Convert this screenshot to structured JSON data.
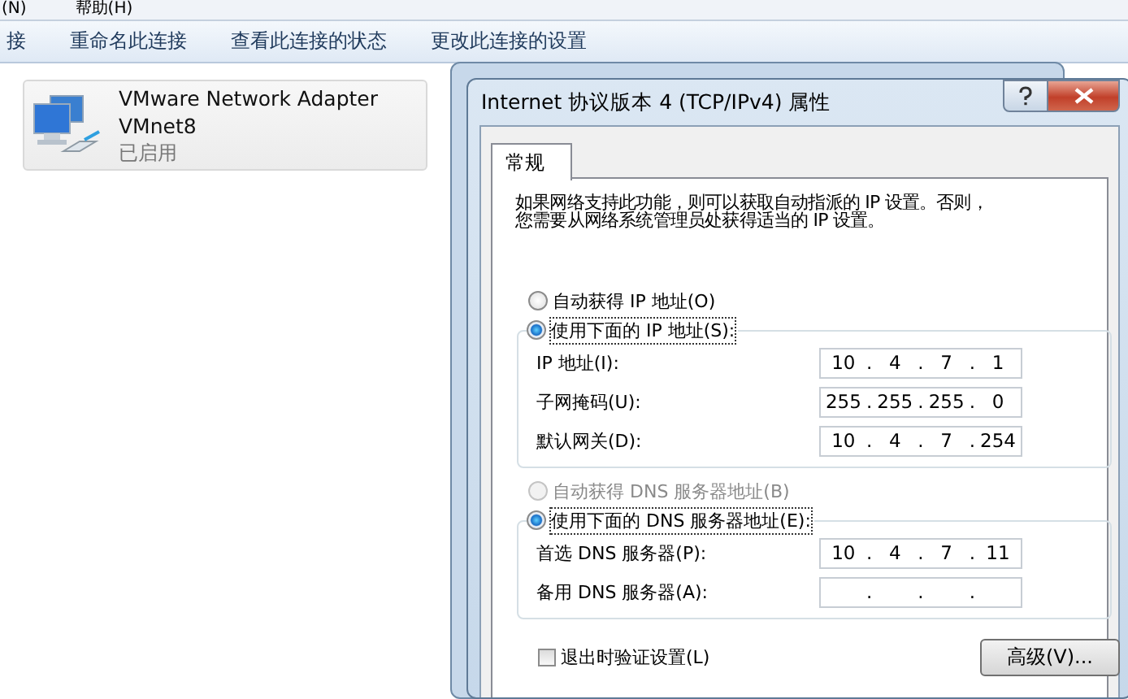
{
  "menu_bar": {
    "items": [
      "(N)",
      "帮助(H)"
    ]
  },
  "toolbar": {
    "items": [
      "接",
      "重命名此连接",
      "查看此连接的状态",
      "更改此连接的设置"
    ]
  },
  "adapter": {
    "name": "VMware Network Adapter",
    "network": "VMnet8",
    "status": "已启用"
  },
  "dialog": {
    "title": "Internet 协议版本 4 (TCP/IPv4) 属性",
    "tabs": [
      {
        "label": "常规",
        "selected": true
      }
    ],
    "description_lines": [
      "如果网络支持此功能，则可以获取自动指派的 IP 设置。否则，",
      "您需要从网络系统管理员处获得适当的 IP 设置。"
    ],
    "ip_mode": [
      {
        "label": "自动获得 IP 地址(O)",
        "selected": false,
        "disabled": false
      },
      {
        "label": "使用下面的 IP 地址(S):",
        "selected": true,
        "disabled": false
      }
    ],
    "ip_fields": [
      {
        "label": "IP 地址(I):",
        "octets": [
          "10",
          "4",
          "7",
          "1"
        ]
      },
      {
        "label": "子网掩码(U):",
        "octets": [
          "255",
          "255",
          "255",
          "0"
        ]
      },
      {
        "label": "默认网关(D):",
        "octets": [
          "10",
          "4",
          "7",
          "254"
        ]
      }
    ],
    "dns_mode": [
      {
        "label": "自动获得 DNS 服务器地址(B)",
        "selected": false,
        "disabled": true
      },
      {
        "label": "使用下面的 DNS 服务器地址(E):",
        "selected": true,
        "disabled": false
      }
    ],
    "dns_fields": [
      {
        "label": "首选 DNS 服务器(P):",
        "octets": [
          "10",
          "4",
          "7",
          "11"
        ]
      },
      {
        "label": "备用 DNS 服务器(A):"
      }
    ],
    "separator": ".",
    "validate_on_exit": {
      "label": "退出时验证设置(L)",
      "checked": false
    },
    "advanced_button": "高级(V)..."
  }
}
